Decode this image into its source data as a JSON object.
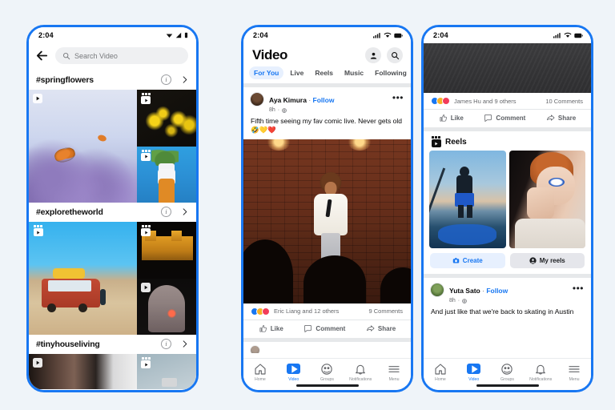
{
  "meta": {
    "background_color": "#eff4f9",
    "accent_color": "#1877f2"
  },
  "phone1": {
    "status": {
      "time": "2:04"
    },
    "search": {
      "placeholder": "Search Video",
      "back_icon": "back-arrow-icon",
      "search_icon": "search-icon"
    },
    "sections": [
      {
        "hashtag": "#springflowers",
        "info_label": "i",
        "chevron": "›"
      },
      {
        "hashtag": "#exploretheworld",
        "info_label": "i",
        "chevron": "›"
      },
      {
        "hashtag": "#tinyhouseliving",
        "info_label": "i",
        "chevron": "›"
      }
    ]
  },
  "phone2": {
    "status": {
      "time": "2:04"
    },
    "header": {
      "title": "Video",
      "profile_icon": "profile-icon",
      "search_icon": "search-icon"
    },
    "tabs": [
      {
        "label": "For You",
        "active": true
      },
      {
        "label": "Live",
        "active": false
      },
      {
        "label": "Reels",
        "active": false
      },
      {
        "label": "Music",
        "active": false
      },
      {
        "label": "Following",
        "active": false
      }
    ],
    "post": {
      "author": "Aya Kimura",
      "separator": "·",
      "follow_label": "Follow",
      "time": "8h",
      "privacy_dot": "·",
      "menu_icon": "more-options-icon",
      "text": "Fifth time seeing my fav comic live. Never gets old",
      "emoji": "🤣💛❤️"
    },
    "reactions": {
      "names": "Eric Liang and 12 others",
      "comments": "9 Comments"
    },
    "actions": [
      {
        "label": "Like",
        "icon": "thumbs-up-icon"
      },
      {
        "label": "Comment",
        "icon": "comment-bubble-icon"
      },
      {
        "label": "Share",
        "icon": "share-arrow-icon"
      }
    ],
    "nav": [
      {
        "label": "Home",
        "icon": "home-icon",
        "active": false
      },
      {
        "label": "Video",
        "icon": "video-play-icon",
        "active": true
      },
      {
        "label": "Groups",
        "icon": "groups-icon",
        "active": false
      },
      {
        "label": "Notifications",
        "icon": "bell-icon",
        "active": false
      },
      {
        "label": "Menu",
        "icon": "hamburger-menu-icon",
        "active": false
      }
    ]
  },
  "phone3": {
    "status": {
      "time": "2:04"
    },
    "reactions": {
      "names": "James Hu and 9 others",
      "comments": "10 Comments"
    },
    "actions": [
      {
        "label": "Like",
        "icon": "thumbs-up-icon"
      },
      {
        "label": "Comment",
        "icon": "comment-bubble-icon"
      },
      {
        "label": "Share",
        "icon": "share-arrow-icon"
      }
    ],
    "reels": {
      "title": "Reels",
      "icon": "reels-icon",
      "buttons": [
        {
          "label": "Create",
          "icon": "camera-icon"
        },
        {
          "label": "My reels",
          "icon": "person-circle-icon"
        }
      ]
    },
    "post": {
      "author": "Yuta Sato",
      "separator": "·",
      "follow_label": "Follow",
      "time": "8h",
      "privacy_dot": "·",
      "menu_icon": "more-options-icon",
      "text": "And just like that we're back to skating in Austin"
    },
    "nav": [
      {
        "label": "Home",
        "icon": "home-icon",
        "active": false
      },
      {
        "label": "Video",
        "icon": "video-play-icon",
        "active": true
      },
      {
        "label": "Groups",
        "icon": "groups-icon",
        "active": false
      },
      {
        "label": "Notifications",
        "icon": "bell-icon",
        "active": false
      },
      {
        "label": "Menu",
        "icon": "hamburger-menu-icon",
        "active": false
      }
    ]
  }
}
